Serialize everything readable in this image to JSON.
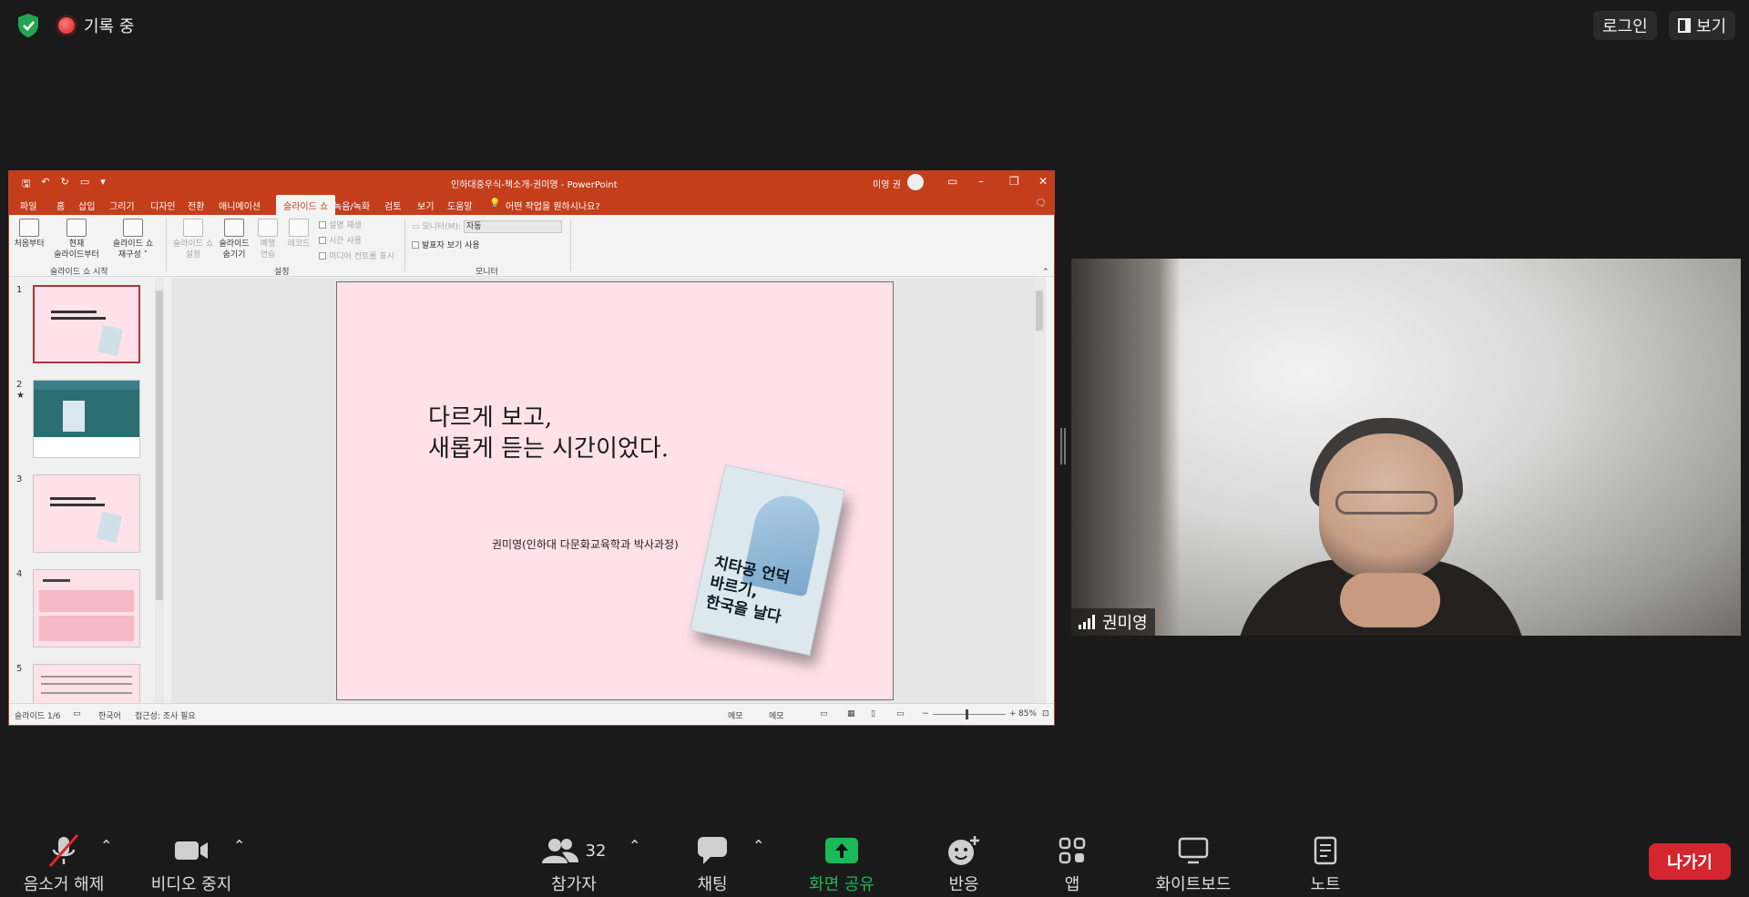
{
  "topbar": {
    "recording_label": "기록 중",
    "login_label": "로그인",
    "view_label": "보기"
  },
  "ppt": {
    "window_title": "인하대중우식-책소개-권미영  -  PowerPoint",
    "user_name": "미영 권",
    "tabs": [
      "파일",
      "홈",
      "삽입",
      "그리기",
      "디자인",
      "전환",
      "애니메이션",
      "슬라이드 쇼",
      "녹음/녹화",
      "검토",
      "보기",
      "도움말"
    ],
    "tell_me": "어떤 작업을 원하시나요?",
    "ribbon": {
      "from_start": "처음부터",
      "from_current_1": "현재",
      "from_current_2": "슬라이드부터",
      "custom_1": "슬라이드 쇼",
      "custom_2": "재구성 ˅",
      "group_start": "슬라이드 쇼 시작",
      "setup_1": "슬라이드 쇼",
      "setup_2": "설정",
      "hide_1": "슬라이드",
      "hide_2": "숨기기",
      "rehearse_1": "예행",
      "rehearse_2": "연습",
      "record": "레코드",
      "narration": "설명 재생",
      "timing": "시간 사용",
      "media_controls": "미디어 컨트롤 표시",
      "group_setup": "설정",
      "monitor_label": "모니터(M):",
      "monitor_value": "자동",
      "presenter_view": "발표자 보기 사용",
      "group_monitor": "모니터"
    },
    "thumb_numbers": [
      "1",
      "2",
      "3",
      "4",
      "5"
    ],
    "slide": {
      "title": "다르게 보고,\n새롭게 듣는 시간이었다.",
      "subtitle": "권미영(인하대 다문화교육학과 박사과정)",
      "book_title": "치타공 언덕\n바르기,\n한국을 날다"
    },
    "status": {
      "slide_count": "슬라이드 1/6",
      "language": "한국어",
      "accessibility": "접근성: 조사 필요",
      "notes": "메모",
      "comments": "메모",
      "zoom": "85%"
    }
  },
  "video": {
    "participant_name": "권미영"
  },
  "toolbar": {
    "mute_label": "음소거 해제",
    "video_label": "비디오 중지",
    "participants_label": "참가자",
    "participants_count": "32",
    "chat_label": "채팅",
    "share_label": "화면 공유",
    "react_label": "반응",
    "apps_label": "앱",
    "whiteboard_label": "화이트보드",
    "notes_label": "노트",
    "leave_label": "나가기"
  },
  "colors": {
    "ppt_accent": "#c43e1c",
    "share_green": "#1bb85a",
    "leave_red": "#d5252f",
    "slide_bg": "#ffe1ea"
  }
}
